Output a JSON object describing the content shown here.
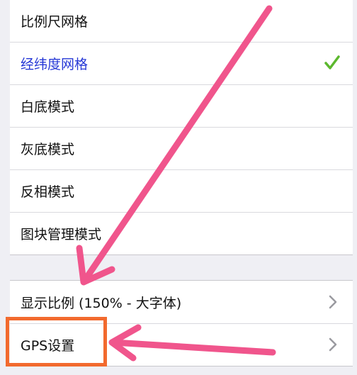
{
  "menu": {
    "items": [
      {
        "label": "比例尺网格"
      },
      {
        "label": "经纬度网格",
        "selected": true
      },
      {
        "label": "白底模式"
      },
      {
        "label": "灰底模式"
      },
      {
        "label": "反相模式"
      },
      {
        "label": "图块管理模式"
      }
    ]
  },
  "settings": {
    "items": [
      {
        "label": "显示比例 (150% - 大字体)"
      },
      {
        "label": "GPS设置"
      }
    ]
  },
  "colors": {
    "selected_text": "#2638d6",
    "checkmark": "#5cb82e",
    "annotation_arrow": "#f0558c",
    "highlight_box": "#f26a2e"
  },
  "icons": [
    "checkmark-icon",
    "chevron-right-icon"
  ]
}
